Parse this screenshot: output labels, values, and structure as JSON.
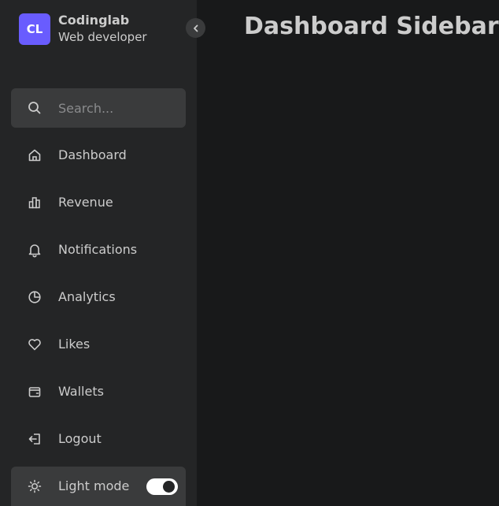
{
  "brand": {
    "logo_text": "CL",
    "name": "Codinglab",
    "role": "Web developer",
    "accent_color": "#695cfe"
  },
  "search": {
    "placeholder": "Search...",
    "value": "",
    "icon": "search-icon"
  },
  "nav": {
    "items": [
      {
        "label": "Dashboard",
        "icon": "home-icon"
      },
      {
        "label": "Revenue",
        "icon": "bar-chart-icon"
      },
      {
        "label": "Notifications",
        "icon": "bell-icon"
      },
      {
        "label": "Analytics",
        "icon": "pie-chart-icon"
      },
      {
        "label": "Likes",
        "icon": "heart-icon"
      },
      {
        "label": "Wallets",
        "icon": "wallet-icon"
      }
    ],
    "logout": {
      "label": "Logout",
      "icon": "logout-icon"
    }
  },
  "mode": {
    "label": "Light mode",
    "icon": "sun-icon",
    "toggle_on": true
  },
  "main": {
    "title": "Dashboard Sidebar"
  },
  "colors": {
    "sidebar_bg": "#242526",
    "body_bg": "#18191a",
    "text": "#cccccc",
    "control_bg": "#3a3b3c"
  }
}
